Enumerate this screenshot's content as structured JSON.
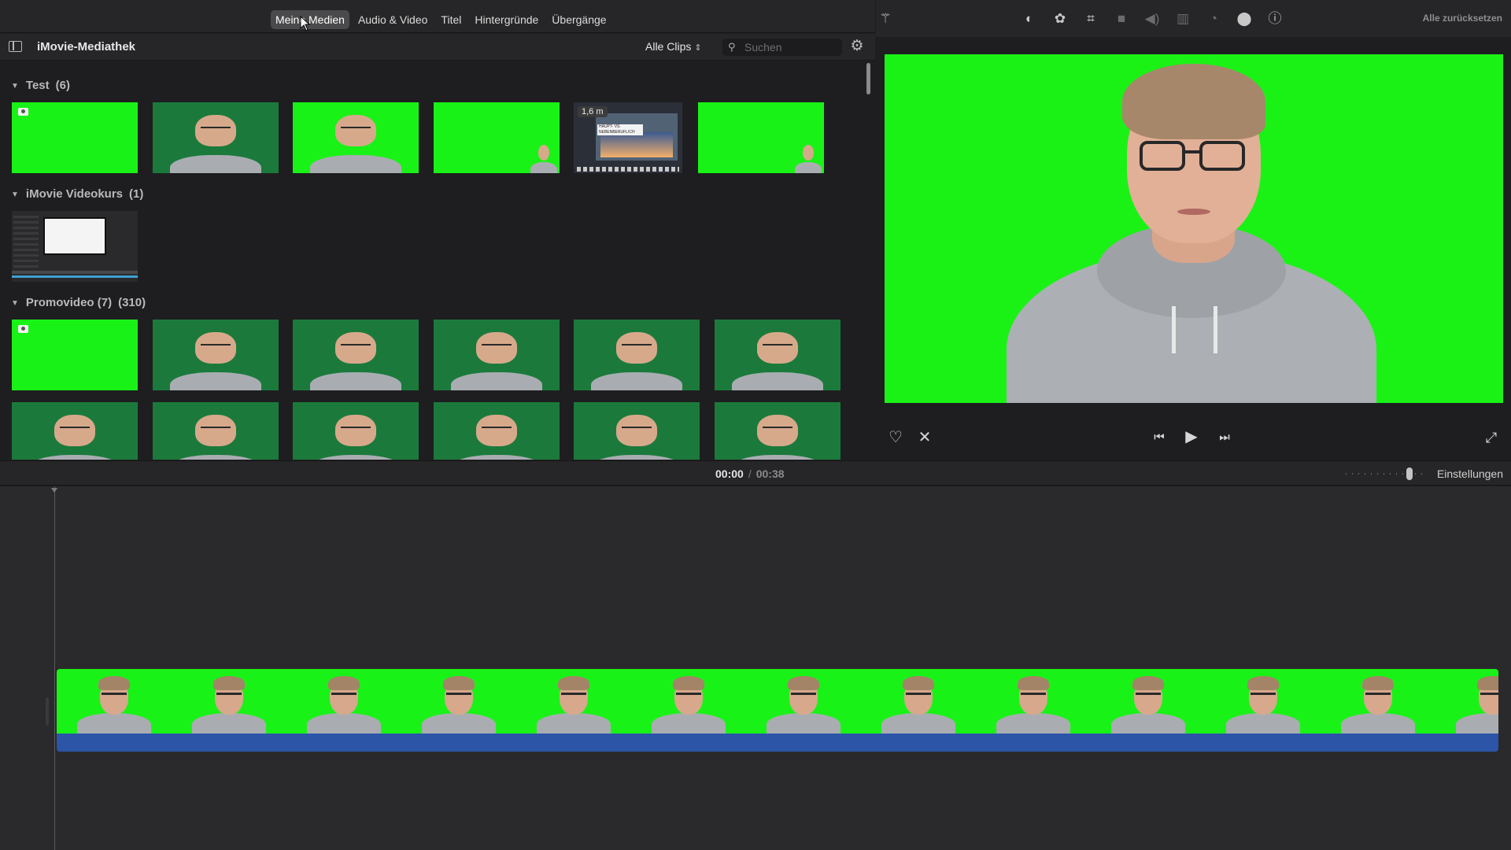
{
  "media_tabs": [
    {
      "label": "Meine Medien",
      "active": true
    },
    {
      "label": "Audio & Video",
      "active": false
    },
    {
      "label": "Titel",
      "active": false
    },
    {
      "label": "Hintergründe",
      "active": false
    },
    {
      "label": "Übergänge",
      "active": false
    }
  ],
  "library": {
    "title": "iMovie-Mediathek",
    "filter": "Alle Clips",
    "search_placeholder": "Suchen",
    "events": [
      {
        "name": "Test",
        "count": "(6)",
        "extra": ""
      },
      {
        "name": "iMovie Videokurs",
        "count": "(1)",
        "extra": ""
      },
      {
        "name": "Promovideo (7)",
        "count": "(310)",
        "extra": ""
      }
    ],
    "screenshot_badge": "1,6 m",
    "screenshot_caption": "HAUPT- VS. NEBENBERUFLICH"
  },
  "viewer": {
    "reset_all": "Alle zurücksetzen",
    "toolbar_icons": [
      "magic-wand",
      "color-balance",
      "color-correction",
      "crop",
      "stabilization",
      "volume",
      "noise-reduction",
      "speed",
      "clip-filter",
      "info"
    ]
  },
  "timebar": {
    "current": "00:00",
    "separator": "/",
    "total": "00:38",
    "settings": "Einstellungen"
  },
  "colors": {
    "chroma_green": "#19f217",
    "audio_blue": "#2c55a8",
    "panel_bg": "#1e1e20",
    "toolbar_bg": "#262628"
  }
}
